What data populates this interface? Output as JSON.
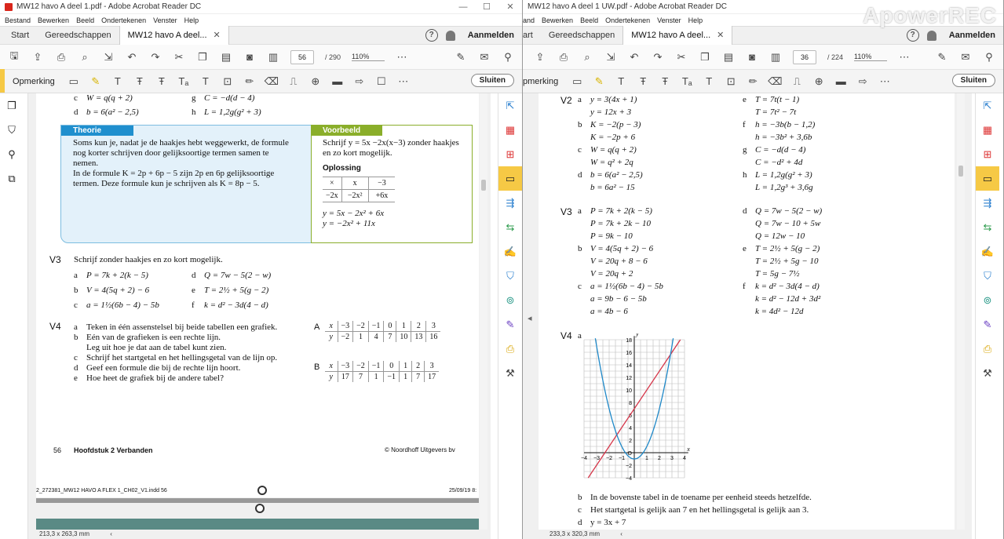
{
  "left": {
    "title": "MW12 havo A deel 1.pdf - Adobe Acrobat Reader DC",
    "menu": [
      "Bestand",
      "Bewerken",
      "Beeld",
      "Ondertekenen",
      "Venster",
      "Help"
    ],
    "tabs": {
      "start": "Start",
      "tools": "Gereedschappen",
      "doc": "MW12 havo A deel..."
    },
    "login": "Aanmelden",
    "page_current": "56",
    "page_total": "/ 290",
    "zoom": "110%",
    "comment_label": "Opmerking",
    "close_label": "Sluiten",
    "status": "213,3 x 263,3 mm",
    "content": {
      "top_c": "c",
      "top_c_expr": "W = q(q + 2)",
      "top_g": "g",
      "top_g_expr": "C = −d(d − 4)",
      "top_d": "d",
      "top_d_expr": "b = 6(a² − 2,5)",
      "top_h": "h",
      "top_h_expr": "L = 1,2g(g² + 3)",
      "theorie_title": "Theorie",
      "theorie_lines": [
        "Soms kun je, nadat je de haakjes hebt weggewerkt, de formule",
        "nog korter schrijven door gelijksoortige termen samen te",
        "nemen.",
        "In de formule K = 2p + 6p − 5 zijn 2p en 6p gelijksoortige",
        "termen. Deze formule kun je schrijven als K = 8p − 5."
      ],
      "voorbeeld_title": "Voorbeeld",
      "voorbeeld_lines": [
        "Schrijf y = 5x −2x(x−3) zonder haakjes",
        "en zo kort mogelijk."
      ],
      "oplossing": "Oplossing",
      "vb_table": [
        [
          "×",
          "x",
          "−3"
        ],
        [
          "−2x",
          "−2x²",
          "+6x"
        ]
      ],
      "vb_result": [
        "y = 5x − 2x² + 6x",
        "y = −2x² + 11x"
      ],
      "v3_num": "V3",
      "v3_text": "Schrijf zonder haakjes en zo kort mogelijk.",
      "v3_items": [
        [
          "a",
          "P = 7k + 2(k − 5)",
          "d",
          "Q = 7w − 5(2 − w)"
        ],
        [
          "b",
          "V = 4(5q + 2) − 6",
          "e",
          "T = 2½ + 5(g − 2)"
        ],
        [
          "c",
          "a = 1½(6b − 4) − 5b",
          "f",
          "k = d² − 3d(4 − d)"
        ]
      ],
      "v4_num": "V4",
      "v4_items": [
        [
          "a",
          "Teken in één assenstelsel bij beide tabellen een grafiek."
        ],
        [
          "b",
          "Eén van de grafieken is een rechte lijn."
        ],
        [
          "",
          "Leg uit hoe je dat aan de tabel kunt zien."
        ],
        [
          "c",
          "Schrijf het startgetal en het hellingsgetal van de lijn op."
        ],
        [
          "d",
          "Geef een formule die bij de rechte lijn hoort."
        ],
        [
          "e",
          "Hoe heet de grafiek bij de andere tabel?"
        ]
      ],
      "tableA_label": "A",
      "tableA": [
        [
          "x",
          "−3",
          "−2",
          "−1",
          "0",
          "1",
          "2",
          "3"
        ],
        [
          "y",
          "−2",
          "1",
          "4",
          "7",
          "10",
          "13",
          "16"
        ]
      ],
      "tableB_label": "B",
      "tableB": [
        [
          "x",
          "−3",
          "−2",
          "−1",
          "0",
          "1",
          "2",
          "3"
        ],
        [
          "y",
          "17",
          "7",
          "1",
          "−1",
          "1",
          "7",
          "17"
        ]
      ],
      "footer_page": "56",
      "footer_chapter": "Hoofdstuk 2 Verbanden",
      "footer_pub": "© Noordhoff Uitgevers bv",
      "print_left": "2_272381_MW12 HAVO A FLEX 1_CH02_V1.indd   56",
      "print_right": "25/09/19   8:"
    }
  },
  "right": {
    "title": "MW12 havo A deel 1 UW.pdf - Adobe Acrobat Reader DC",
    "menu": [
      "and",
      "Bewerken",
      "Beeld",
      "Ondertekenen",
      "Venster",
      "Help"
    ],
    "tabs": {
      "start": "art",
      "tools": "Gereedschappen",
      "doc": "MW12 havo A deel..."
    },
    "login": "Aanmelden",
    "page_current": "36",
    "page_total": "/ 224",
    "zoom": "110%",
    "comment_label": "pmerking",
    "close_label": "Sluiten",
    "status": "233,3 x 320,3 mm",
    "content": {
      "v2_num": "V2",
      "v2_rows": [
        [
          "a",
          "y = 3(4x + 1)",
          "e",
          "T = 7t(t − 1)"
        ],
        [
          "",
          "y = 12x + 3",
          "",
          "T = 7t² − 7t"
        ],
        [
          "b",
          "K = −2(p − 3)",
          "f",
          "h = −3b(b − 1,2)"
        ],
        [
          "",
          "K = −2p + 6",
          "",
          "h = −3b² + 3,6b"
        ],
        [
          "c",
          "W = q(q + 2)",
          "g",
          "C = −d(d − 4)"
        ],
        [
          "",
          "W = q² + 2q",
          "",
          "C = −d² + 4d"
        ],
        [
          "d",
          "b = 6(a² − 2,5)",
          "h",
          "L = 1,2g(g² + 3)"
        ],
        [
          "",
          "b = 6a² − 15",
          "",
          "L = 1,2g³ + 3,6g"
        ]
      ],
      "v3_num": "V3",
      "v3_rows": [
        [
          "a",
          "P = 7k + 2(k − 5)",
          "d",
          "Q = 7w − 5(2 − w)"
        ],
        [
          "",
          "P = 7k + 2k − 10",
          "",
          "Q = 7w − 10 + 5w"
        ],
        [
          "",
          "P = 9k − 10",
          "",
          "Q = 12w − 10"
        ],
        [
          "b",
          "V = 4(5q + 2) − 6",
          "e",
          "T = 2½ + 5(g − 2)"
        ],
        [
          "",
          "V = 20q + 8 − 6",
          "",
          "T = 2½ + 5g − 10"
        ],
        [
          "",
          "V = 20q + 2",
          "",
          "T = 5g − 7½"
        ],
        [
          "c",
          "a = 1½(6b − 4) − 5b",
          "f",
          "k = d² − 3d(4 − d)"
        ],
        [
          "",
          "a = 9b − 6 − 5b",
          "",
          "k = d² − 12d + 3d²"
        ],
        [
          "",
          "a = 4b − 6",
          "",
          "k = 4d² − 12d"
        ]
      ],
      "v4_num": "V4",
      "v4_a": "a",
      "graph_y_label": "y",
      "graph_x_label": "x",
      "graph_y_ticks": [
        "18",
        "16",
        "14",
        "12",
        "10",
        "8",
        "6",
        "4",
        "2",
        "O",
        "−2",
        "−4"
      ],
      "graph_x_ticks": [
        "−4",
        "−3",
        "−2",
        "−1",
        "1",
        "2",
        "3",
        "4"
      ],
      "v4_rest": [
        [
          "b",
          "In de bovenste tabel in de toename per eenheid steeds hetzelfde."
        ],
        [
          "c",
          "Het startgetal is gelijk aan 7 en het hellingsgetal is gelijk aan 3."
        ],
        [
          "d",
          "y = 3x + 7"
        ]
      ]
    }
  },
  "watermark": "ApowerREC",
  "colors": {
    "theorie": "#1f8fce",
    "voorbeeld": "#8aae2a",
    "theorie_bg": "#e3f1fa",
    "selected": "#f6c945",
    "line_red": "#d6364a",
    "parabola_blue": "#1e88c8"
  }
}
